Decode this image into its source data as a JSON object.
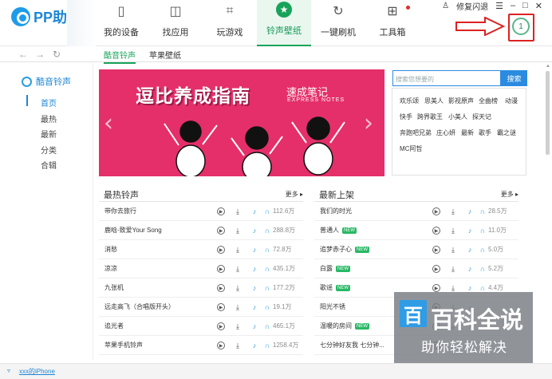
{
  "app": {
    "logo": "PP助手",
    "user": "修复闪退"
  },
  "nav": [
    {
      "label": "我的设备",
      "icon": "phone-icon"
    },
    {
      "label": "找应用",
      "icon": "bag-icon"
    },
    {
      "label": "玩游戏",
      "icon": "gamepad-icon"
    },
    {
      "label": "铃声壁纸",
      "icon": "star-icon",
      "active": true
    },
    {
      "label": "一键刷机",
      "icon": "refresh-icon"
    },
    {
      "label": "工具箱",
      "icon": "toolbox-icon"
    }
  ],
  "device": {
    "number": "1"
  },
  "subtabs": [
    "酷音铃声",
    "苹果壁纸"
  ],
  "sidebar": {
    "title": "酷音铃声",
    "items": [
      "首页",
      "最热",
      "最新",
      "分类",
      "合辑"
    ]
  },
  "banner": {
    "title": "逗比养成指南",
    "sub": "速成笔记",
    "en": "EXPRESS NOTES"
  },
  "search": {
    "placeholder": "搜索您想要的",
    "button": "搜索"
  },
  "tags": [
    "欢乐颂",
    "思美人",
    "影视原声",
    "全曲榜",
    "动漫",
    "快手",
    "跨界歌王",
    "小美人",
    "探天记",
    "奔跑吧兄弟",
    "庄心妍",
    "最新",
    "歌手",
    "霸之谜",
    "MC阿哲"
  ],
  "hot": {
    "title": "最热铃声",
    "more": "更多",
    "rows": [
      {
        "name": "带你去旅行",
        "badge": "",
        "count": "112.6万"
      },
      {
        "name": "鹿晗-致爱Your Song",
        "badge": "",
        "count": "288.8万"
      },
      {
        "name": "消愁",
        "badge": "",
        "count": "72.8万"
      },
      {
        "name": "凉凉",
        "badge": "",
        "count": "435.1万"
      },
      {
        "name": "九张机",
        "badge": "",
        "count": "177.2万"
      },
      {
        "name": "远走高飞（合唱版开头）",
        "badge": "",
        "count": "19.1万"
      },
      {
        "name": "追光者",
        "badge": "",
        "count": "465.1万"
      },
      {
        "name": "苹果手机铃声",
        "badge": "",
        "count": "1258.4万"
      }
    ]
  },
  "new": {
    "title": "最新上架",
    "more": "更多",
    "rows": [
      {
        "name": "我们的时光",
        "badge": "",
        "count": "28.5万"
      },
      {
        "name": "普通人",
        "badge": "NEW",
        "count": "11.0万"
      },
      {
        "name": "追梦赤子心",
        "badge": "NEW",
        "count": "5.0万"
      },
      {
        "name": "白露",
        "badge": "NEW",
        "count": "5.2万"
      },
      {
        "name": "歌谣",
        "badge": "NEW",
        "count": "4.4万"
      },
      {
        "name": "阳光不锈",
        "badge": "",
        "count": ""
      },
      {
        "name": "温暖的房间",
        "badge": "NEW",
        "count": ""
      },
      {
        "name": "七分钟好友我 七分钟...",
        "badge": "",
        "count": ""
      }
    ]
  },
  "watermark": {
    "logo": "百",
    "main": "百科全说",
    "sub": "助你轻松解决"
  },
  "status": {
    "device": "xxx的iPhone"
  }
}
